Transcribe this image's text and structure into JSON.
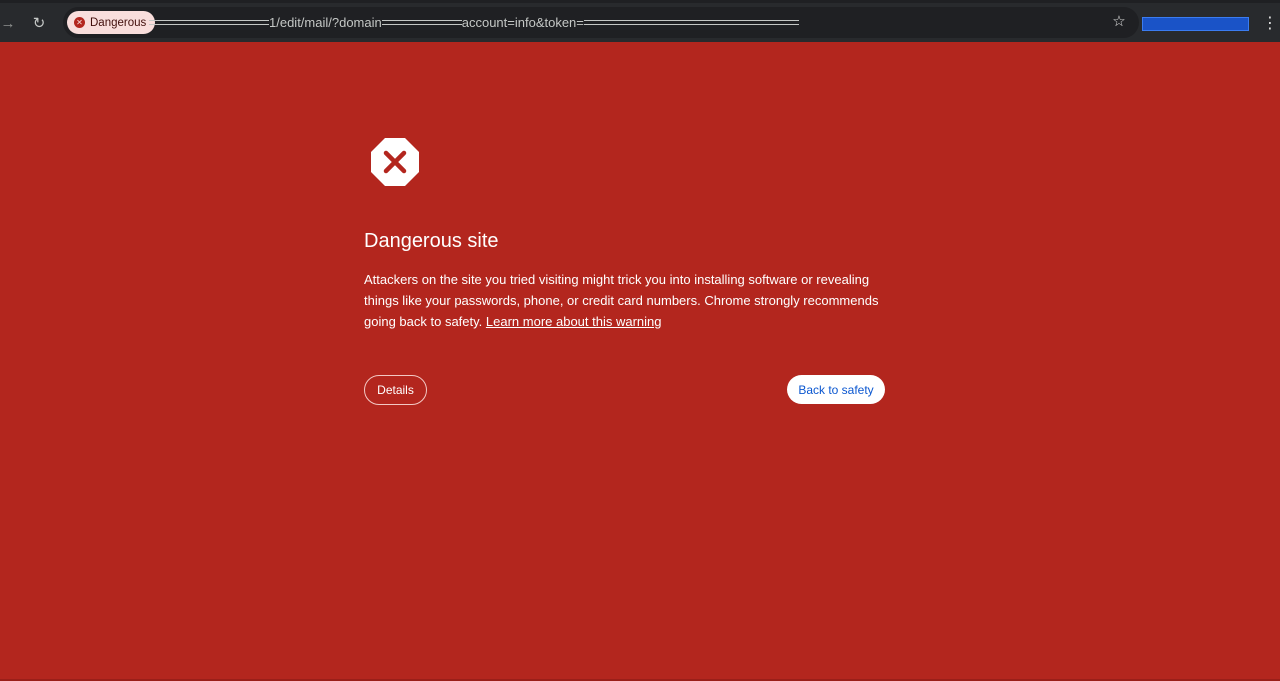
{
  "browser": {
    "security_chip": "Dangerous",
    "url_part_1": "1/edit/mail/?domain",
    "url_part_2": "account=info&token="
  },
  "interstitial": {
    "title": "Dangerous site",
    "description": "Attackers on the site you tried visiting might trick you into installing software or revealing things like your passwords, phone, or credit card numbers. Chrome strongly recommends going back to safety.",
    "learn_more": "Learn more about this warning",
    "details_button": "Details",
    "back_button": "Back to safety"
  },
  "colors": {
    "background": "#b3261e",
    "chip_background": "#f9dedc",
    "primary_button_text": "#0b57d0"
  }
}
